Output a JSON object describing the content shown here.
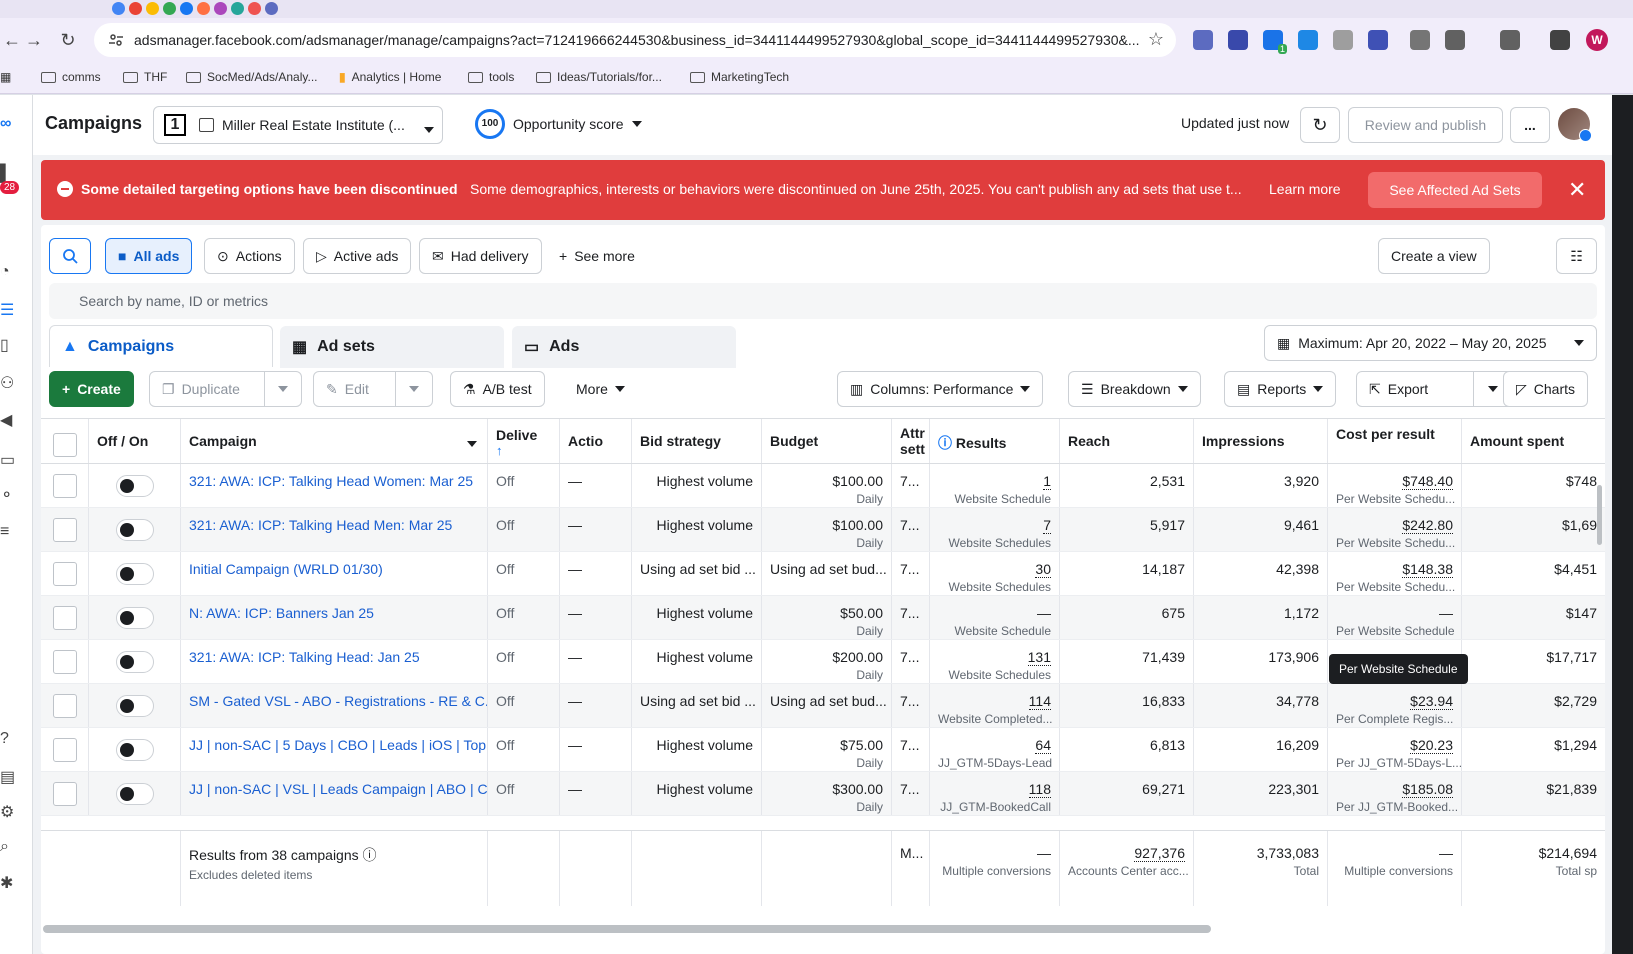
{
  "browser": {
    "url": "adsmanager.facebook.com/adsmanager/manage/campaigns?act=712419666244530&business_id=3441144499527930&global_scope_id=3441144499527930&...",
    "profile_initial": "W",
    "extension_badge": "1",
    "bookmarks": [
      "comms",
      "THF",
      "SocMed/Ads/Analy...",
      "Analytics | Home",
      "tools",
      "Ideas/Tutorials/for...",
      "MarketingTech"
    ]
  },
  "leftnav": {
    "notification_count": "28"
  },
  "header": {
    "title": "Campaigns",
    "account_name": "Miller Real Estate Institute (...",
    "opportunity_score_value": "100",
    "opportunity_score_label": "Opportunity score",
    "updated": "Updated just now",
    "review_publish": "Review and publish",
    "more": "..."
  },
  "banner": {
    "heading": "Some detailed targeting options have been discontinued",
    "message": "Some demographics, interests or behaviors were discontinued on June 25th, 2025. You can't publish any ad sets that use t...",
    "learn_more": "Learn more",
    "see_affected": "See Affected Ad Sets",
    "close": "✕"
  },
  "filters": {
    "all_ads": "All ads",
    "actions": "Actions",
    "active_ads": "Active ads",
    "had_delivery": "Had delivery",
    "see_more": "See more",
    "create_view": "Create a view",
    "search_placeholder": "Search by name, ID or metrics"
  },
  "tabs": {
    "campaigns": "Campaigns",
    "ad_sets": "Ad sets",
    "ads": "Ads"
  },
  "date_range": "Maximum: Apr 20, 2022 – May 20, 2025",
  "toolbar": {
    "create": "Create",
    "duplicate": "Duplicate",
    "edit": "Edit",
    "ab_test": "A/B test",
    "more": "More",
    "columns": "Columns: Performance",
    "breakdown": "Breakdown",
    "reports": "Reports",
    "export": "Export",
    "charts": "Charts"
  },
  "columns": {
    "off_on": "Off / On",
    "campaign": "Campaign",
    "delivery": "Delive",
    "actions": "Actio",
    "bid_strategy": "Bid strategy",
    "budget": "Budget",
    "attribution": "Attr sett",
    "results": "Results",
    "reach": "Reach",
    "impressions": "Impressions",
    "cost_per_result": "Cost per result",
    "amount_spent": "Amount spent"
  },
  "rows": [
    {
      "campaign": "321: AWA: ICP: Talking Head Women: Mar 25",
      "delivery": "Off",
      "actions": "—",
      "bid": "Highest volume",
      "budget": "$100.00",
      "budget_sub": "Daily",
      "attr": "7...",
      "results": "1",
      "results_sub": "Website Schedule",
      "reach": "2,531",
      "impressions": "3,920",
      "cpr": "$748.40",
      "cpr_sub": "Per Website Schedu...",
      "spent": "$748"
    },
    {
      "campaign": "321: AWA: ICP: Talking Head Men: Mar 25",
      "delivery": "Off",
      "actions": "—",
      "bid": "Highest volume",
      "budget": "$100.00",
      "budget_sub": "Daily",
      "attr": "7...",
      "results": "7",
      "results_sub": "Website Schedules",
      "reach": "5,917",
      "impressions": "9,461",
      "cpr": "$242.80",
      "cpr_sub": "Per Website Schedu...",
      "spent": "$1,69"
    },
    {
      "campaign": "Initial Campaign (WRLD 01/30)",
      "delivery": "Off",
      "actions": "—",
      "bid": "Using ad set bid ...",
      "budget": "Using ad set bud...",
      "budget_sub": "",
      "attr": "7...",
      "results": "30",
      "results_sub": "Website Schedules",
      "reach": "14,187",
      "impressions": "42,398",
      "cpr": "$148.38",
      "cpr_sub": "Per Website Schedu...",
      "spent": "$4,451"
    },
    {
      "campaign": "N: AWA: ICP: Banners Jan 25",
      "delivery": "Off",
      "actions": "—",
      "bid": "Highest volume",
      "budget": "$50.00",
      "budget_sub": "Daily",
      "attr": "7...",
      "results": "—",
      "results_sub": "Website Schedule",
      "reach": "675",
      "impressions": "1,172",
      "cpr": "—",
      "cpr_sub": "Per Website Schedule",
      "spent": "$147"
    },
    {
      "campaign": "321: AWA: ICP: Talking Head: Jan 25",
      "delivery": "Off",
      "actions": "—",
      "bid": "Highest volume",
      "budget": "$200.00",
      "budget_sub": "Daily",
      "attr": "7...",
      "results": "131",
      "results_sub": "Website Schedules",
      "reach": "71,439",
      "impressions": "173,906",
      "cpr": "",
      "cpr_sub": "Per Website Schedu...",
      "spent": "$17,717"
    },
    {
      "campaign": "SM - Gated VSL - ABO - Registrations - RE & C...",
      "delivery": "Off",
      "actions": "—",
      "bid": "Using ad set bid ...",
      "budget": "Using ad set bud...",
      "budget_sub": "",
      "attr": "7...",
      "results": "114",
      "results_sub": "Website Completed...",
      "reach": "16,833",
      "impressions": "34,778",
      "cpr": "$23.94",
      "cpr_sub": "Per Complete Regis...",
      "spent": "$2,729"
    },
    {
      "campaign": "JJ | non-SAC | 5 Days | CBO | Leads | iOS | Top ...",
      "delivery": "Off",
      "actions": "—",
      "bid": "Highest volume",
      "budget": "$75.00",
      "budget_sub": "Daily",
      "attr": "7...",
      "results": "64",
      "results_sub": "JJ_GTM-5Days-Lead",
      "reach": "6,813",
      "impressions": "16,209",
      "cpr": "$20.23",
      "cpr_sub": "Per JJ_GTM-5Days-L...",
      "spent": "$1,294"
    },
    {
      "campaign": "JJ | non-SAC | VSL | Leads Campaign | ABO | Cal...",
      "delivery": "Off",
      "actions": "—",
      "bid": "Highest volume",
      "budget": "$300.00",
      "budget_sub": "Daily",
      "attr": "7...",
      "results": "118",
      "results_sub": "JJ_GTM-BookedCall",
      "reach": "69,271",
      "impressions": "223,301",
      "cpr": "$185.08",
      "cpr_sub": "Per JJ_GTM-Booked...",
      "spent": "$21,839"
    }
  ],
  "footer": {
    "title": "Results from 38 campaigns",
    "subtitle": "Excludes deleted items",
    "attr": "M...",
    "results": "—",
    "results_sub": "Multiple conversions",
    "reach": "927,376",
    "reach_sub": "Accounts Center acc...",
    "impressions": "3,733,083",
    "impressions_sub": "Total",
    "cpr": "—",
    "cpr_sub": "Multiple conversions",
    "spent": "$214,694",
    "spent_sub": "Total sp"
  },
  "tooltip": "Per Website Schedule",
  "colors": {
    "brand": "#1877f2",
    "banner": "#e03d3d",
    "create": "#1b7a3d",
    "link": "#1a5fd1"
  }
}
